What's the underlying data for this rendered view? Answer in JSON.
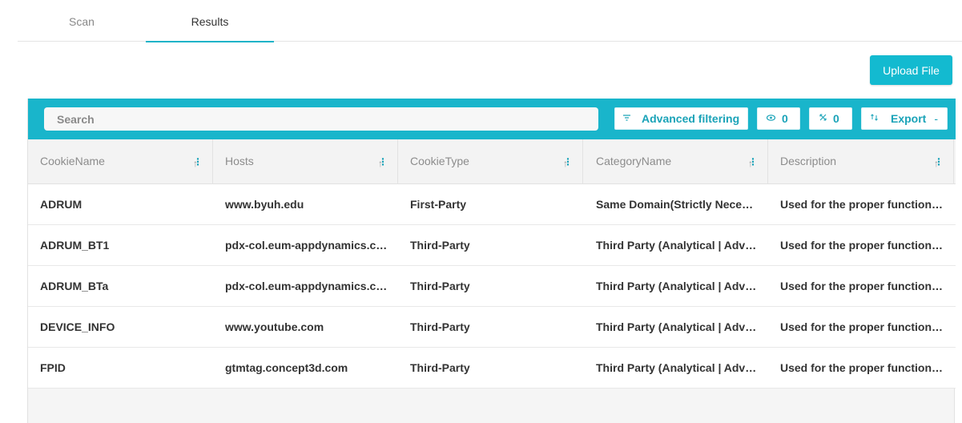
{
  "tabs": [
    {
      "label": "Scan",
      "active": false
    },
    {
      "label": "Results",
      "active": true
    }
  ],
  "upload_label": "Upload File",
  "search": {
    "placeholder": "Search"
  },
  "toolbar": {
    "advanced_filtering_label": "Advanced filtering",
    "view_count": "0",
    "selected_count": "0",
    "export_label": "Export",
    "export_caret": "-"
  },
  "table": {
    "columns": [
      "CookieName",
      "Hosts",
      "CookieType",
      "CategoryName",
      "Description"
    ],
    "rows": [
      [
        "ADRUM",
        "www.byuh.edu",
        "First-Party",
        "Same Domain(Strictly Necessary)",
        "Used for the proper functioning of the website"
      ],
      [
        "ADRUM_BT1",
        "pdx-col.eum-appdynamics.com",
        "Third-Party",
        "Third Party (Analytical | Advertising)",
        "Used for the proper functioning of the website"
      ],
      [
        "ADRUM_BTa",
        "pdx-col.eum-appdynamics.com",
        "Third-Party",
        "Third Party (Analytical | Advertising)",
        "Used for the proper functioning of the website"
      ],
      [
        "DEVICE_INFO",
        "www.youtube.com",
        "Third-Party",
        "Third Party (Analytical | Advertising)",
        "Used for the proper functioning of the website"
      ],
      [
        "FPID",
        "gtmtag.concept3d.com",
        "Third-Party",
        "Third Party (Analytical | Advertising)",
        "Used for the proper functioning of the website"
      ]
    ]
  },
  "colors": {
    "accent": "#19b5cb",
    "button": "#13bad0",
    "accent_text": "#1aa3b8"
  },
  "icons": {
    "advanced_filtering": "filter-icon",
    "view": "eye-icon",
    "selected": "cross-arrows-icon",
    "export": "export-icon",
    "sort": "sort-arrow-icon",
    "column_menu": "vertical-dots-icon"
  }
}
